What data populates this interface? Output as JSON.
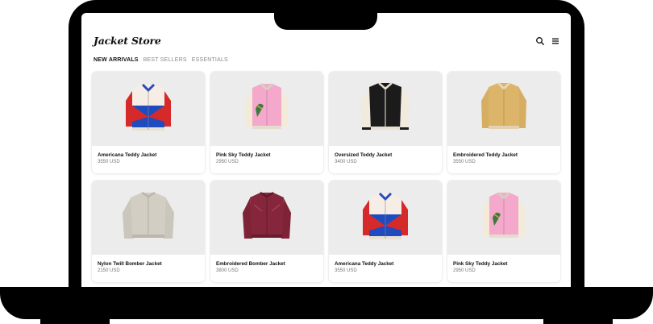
{
  "store": {
    "name": "Jacket Store"
  },
  "header": {
    "search_icon": "search-icon",
    "menu_icon": "menu-icon"
  },
  "nav": {
    "tabs": [
      {
        "label": "NEW ARRIVALS",
        "active": true
      },
      {
        "label": "BEST SELLERS",
        "active": false
      },
      {
        "label": "ESSENTIALS",
        "active": false
      }
    ]
  },
  "products": [
    {
      "name": "Americana Teddy Jacket",
      "price": "3550 USD"
    },
    {
      "name": "Pink Sky Teddy Jacket",
      "price": "2950 USD"
    },
    {
      "name": "Oversized Teddy Jacket",
      "price": "3400 USD"
    },
    {
      "name": "Embroidered Teddy Jacket",
      "price": "3550 USD"
    },
    {
      "name": "Nylon Twill Bomber Jacket",
      "price": "2150 USD"
    },
    {
      "name": "Embroidered Bomber Jacket",
      "price": "3800 USD"
    },
    {
      "name": "Americana Teddy Jacket",
      "price": "3550 USD"
    },
    {
      "name": "Pink Sky Teddy Jacket",
      "price": "2950 USD"
    }
  ],
  "colors": {
    "card_image_bg": "#ececec",
    "accent_text": "#111111",
    "muted_text": "#777777"
  }
}
